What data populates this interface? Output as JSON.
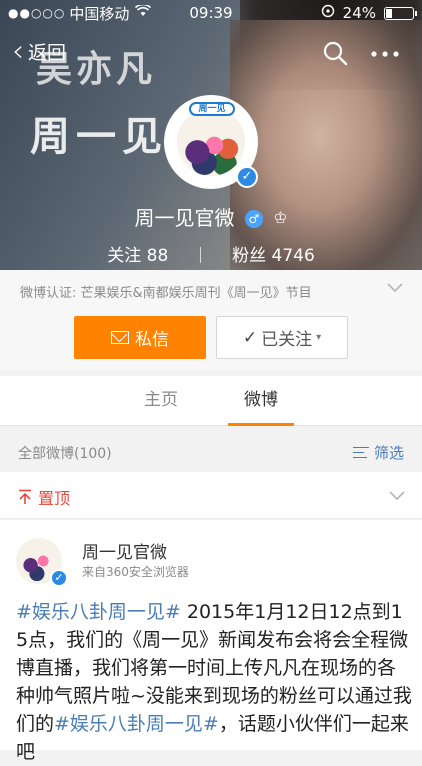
{
  "status_bar": {
    "signal": "●●○○○",
    "carrier": "中国移动",
    "time": "09:39",
    "battery": "24%",
    "battery_level": 0.24
  },
  "nav": {
    "back_label": "返回",
    "search_icon": "search-icon",
    "more_icon": "more-icon"
  },
  "cover": {
    "deco_line1": "吴亦凡",
    "deco_line2": "周一见"
  },
  "profile": {
    "name": "周一见官微",
    "gender_symbol": "♂",
    "crown_symbol": "♔",
    "following_label": "关注",
    "following_count": "88",
    "followers_label": "粉丝",
    "followers_count": "4746",
    "avatar_logo": "周一见"
  },
  "certification": "微博认证: 芒果娱乐&南都娱乐周刊《周一见》节目",
  "actions": {
    "message_label": "私信",
    "follow_label": "已关注",
    "follow_caret": "▾",
    "primary_color": "#ff8200"
  },
  "tabs": [
    {
      "label": "主页",
      "active": false
    },
    {
      "label": "微博",
      "active": true
    }
  ],
  "filter": {
    "all_label": "全部微博(100)",
    "sift_label": "筛选"
  },
  "pinned": {
    "label": "置顶",
    "color": "#e8473b"
  },
  "post": {
    "author": "周一见官微",
    "source": "来自360安全浏览器",
    "topic1": "#娱乐八卦周一见#",
    "text1": " 2015年1月12日12点到15点，我们的《周一见》新闻发布会将会全程微博直播，我们将第一时间上传凡凡在现场的各种帅气照片啦~没能来到现场的粉丝可以通过我们的",
    "topic2": "#娱乐八卦周一见#",
    "text2": "，话题小伙伴们一起来吧"
  }
}
